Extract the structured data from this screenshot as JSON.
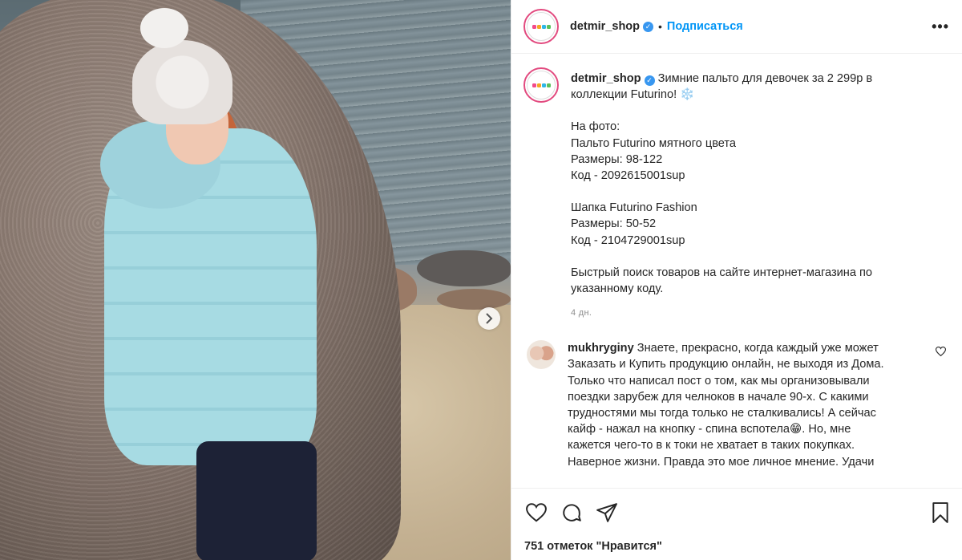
{
  "post": {
    "username": "detmir_shop",
    "follow_label": "Подписаться",
    "more_label": "•••",
    "caption_lines": [
      "Зимние пальто для девочек за 2 299р в",
      "коллекции Futurino! ❄️",
      "",
      "На фото:",
      "Пальто Futurino мятного цвета",
      "Размеры: 98-122",
      "Код - 2092615001sup",
      "",
      "Шапка Futurino Fashion",
      "Размеры: 50-52",
      "Код - 2104729001sup",
      "",
      "Быстрый поиск товаров на сайте интернет-магазина по",
      "указанному коду."
    ],
    "time": "4 дн.",
    "likes": "751 отметок \"Нравится\""
  },
  "comment": {
    "username": "mukhryginy",
    "text_lines": [
      "Знаете, прекрасно, когда каждый уже может",
      "Заказать и Купить продукцию онлайн, не выходя из Дома.",
      "Только что написал пост о том, как мы организовывали",
      "поездки зарубеж для челноков в начале 90-х. С какими",
      "трудностями мы тогда только не сталкивались! А сейчас",
      "кайф - нажал на кнопку - спина вспотела😁. Но, мне",
      "кажется чего-то в к токи не хватает в таких покупках.",
      "Наверное жизни. Правда это мое личное мнение. Удачи"
    ]
  },
  "icons": {
    "verified": "verified-badge-icon",
    "next": "chevron-right-icon",
    "like": "heart-icon",
    "comment": "comment-bubble-icon",
    "share": "paper-plane-icon",
    "save": "bookmark-icon"
  },
  "colors": {
    "link": "#0095f6",
    "verified": "#3897f0",
    "avatar_ring": "#e24a7f"
  }
}
